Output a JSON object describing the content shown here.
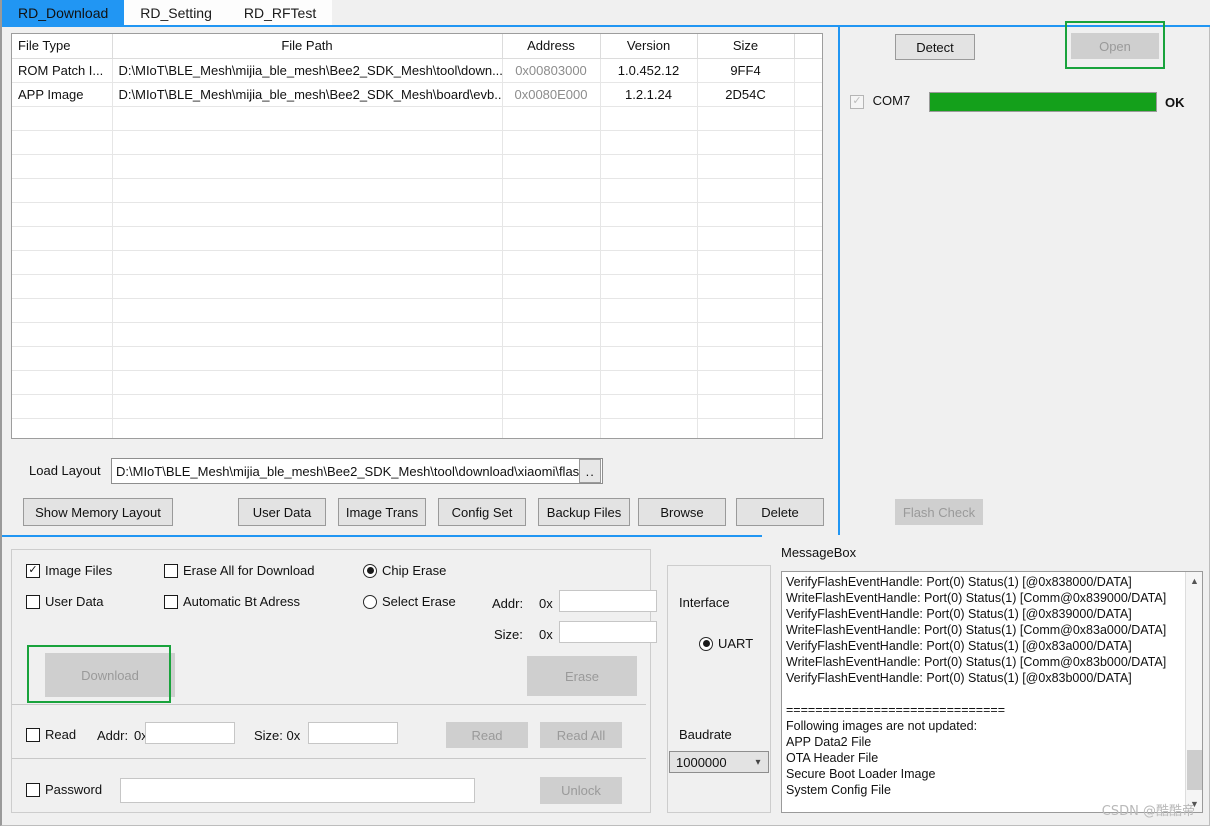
{
  "window": {
    "title": "RD_Download"
  },
  "tabs": [
    {
      "label": "RD_Download",
      "active": true
    },
    {
      "label": "RD_Setting",
      "active": false
    },
    {
      "label": "RD_RFTest",
      "active": false
    }
  ],
  "file_table": {
    "columns": [
      "File Type",
      "File Path",
      "Address",
      "Version",
      "Size"
    ],
    "rows": [
      {
        "file_type": "ROM Patch I...",
        "file_path": "D:\\MIoT\\BLE_Mesh\\mijia_ble_mesh\\Bee2_SDK_Mesh\\tool\\down...",
        "address": "0x00803000",
        "version": "1.0.452.12",
        "size": "9FF4"
      },
      {
        "file_type": "APP Image",
        "file_path": "D:\\MIoT\\BLE_Mesh\\mijia_ble_mesh\\Bee2_SDK_Mesh\\board\\evb...",
        "address": "0x0080E000",
        "version": "1.2.1.24",
        "size": "2D54C"
      }
    ],
    "empty_row_count": 15
  },
  "load_layout": {
    "label": "Load Layout",
    "value": "D:\\MIoT\\BLE_Mesh\\mijia_ble_mesh\\Bee2_SDK_Mesh\\tool\\download\\xiaomi\\flash",
    "browse_label": ".."
  },
  "toolbar": {
    "show_memory_layout": "Show Memory Layout",
    "user_data": "User Data",
    "image_trans": "Image Trans",
    "config_set": "Config Set",
    "backup_files": "Backup Files",
    "browse": "Browse",
    "delete": "Delete"
  },
  "connection": {
    "detect_label": "Detect",
    "open_label": "Open",
    "open_enabled": false,
    "port_label": "COM7",
    "port_checked": true,
    "progress_percent": 100,
    "status_text": "OK",
    "flash_check_label": "Flash Check",
    "flash_check_enabled": false,
    "highlight_color": "#19a33c",
    "progress_color": "#14a01b"
  },
  "options": {
    "image_files": {
      "label": "Image Files",
      "checked": true
    },
    "user_data": {
      "label": "User Data",
      "checked": false
    },
    "erase_all_for_download": {
      "label": "Erase All for Download",
      "checked": false
    },
    "automatic_bt_adress": {
      "label": "Automatic Bt Adress",
      "checked": false
    },
    "chip_erase": {
      "label": "Chip Erase",
      "selected": true
    },
    "select_erase": {
      "label": "Select Erase",
      "selected": false
    },
    "addr_label": "Addr:",
    "addr_prefix": "0x",
    "addr_value": "",
    "size_label": "Size:",
    "size_prefix": "0x",
    "size_value": "",
    "download_label": "Download",
    "download_enabled": false,
    "erase_label": "Erase",
    "erase_enabled": false,
    "read_checkbox": {
      "label": "Read",
      "checked": false
    },
    "read_addr_label": "Addr:",
    "read_addr_prefix": "0x",
    "read_addr_value": "",
    "read_size_label": "Size: 0x",
    "read_size_value": "",
    "read_button": "Read",
    "read_all_button": "Read All",
    "password_checkbox": {
      "label": "Password",
      "checked": false
    },
    "password_value": "",
    "unlock_button": "Unlock"
  },
  "interface": {
    "group_label": "Interface",
    "uart_label": "UART",
    "uart_selected": true,
    "baudrate_label": "Baudrate",
    "baudrate_value": "1000000"
  },
  "message_box": {
    "label": "MessageBox",
    "text": "VerifyFlashEventHandle: Port(0) Status(1) [@0x838000/DATA]\nWriteFlashEventHandle: Port(0) Status(1) [Comm@0x839000/DATA]\nVerifyFlashEventHandle: Port(0) Status(1) [@0x839000/DATA]\nWriteFlashEventHandle: Port(0) Status(1) [Comm@0x83a000/DATA]\nVerifyFlashEventHandle: Port(0) Status(1) [@0x83a000/DATA]\nWriteFlashEventHandle: Port(0) Status(1) [Comm@0x83b000/DATA]\nVerifyFlashEventHandle: Port(0) Status(1) [@0x83b000/DATA]\n\n==============================\nFollowing images are not updated:\nAPP Data2 File\nOTA Header File\nSecure Boot Loader Image\nSystem Config File",
    "scroll_up_icon": "chevron-up",
    "scroll_down_icon": "chevron-down"
  },
  "watermark": "CSDN @酷酷帝"
}
